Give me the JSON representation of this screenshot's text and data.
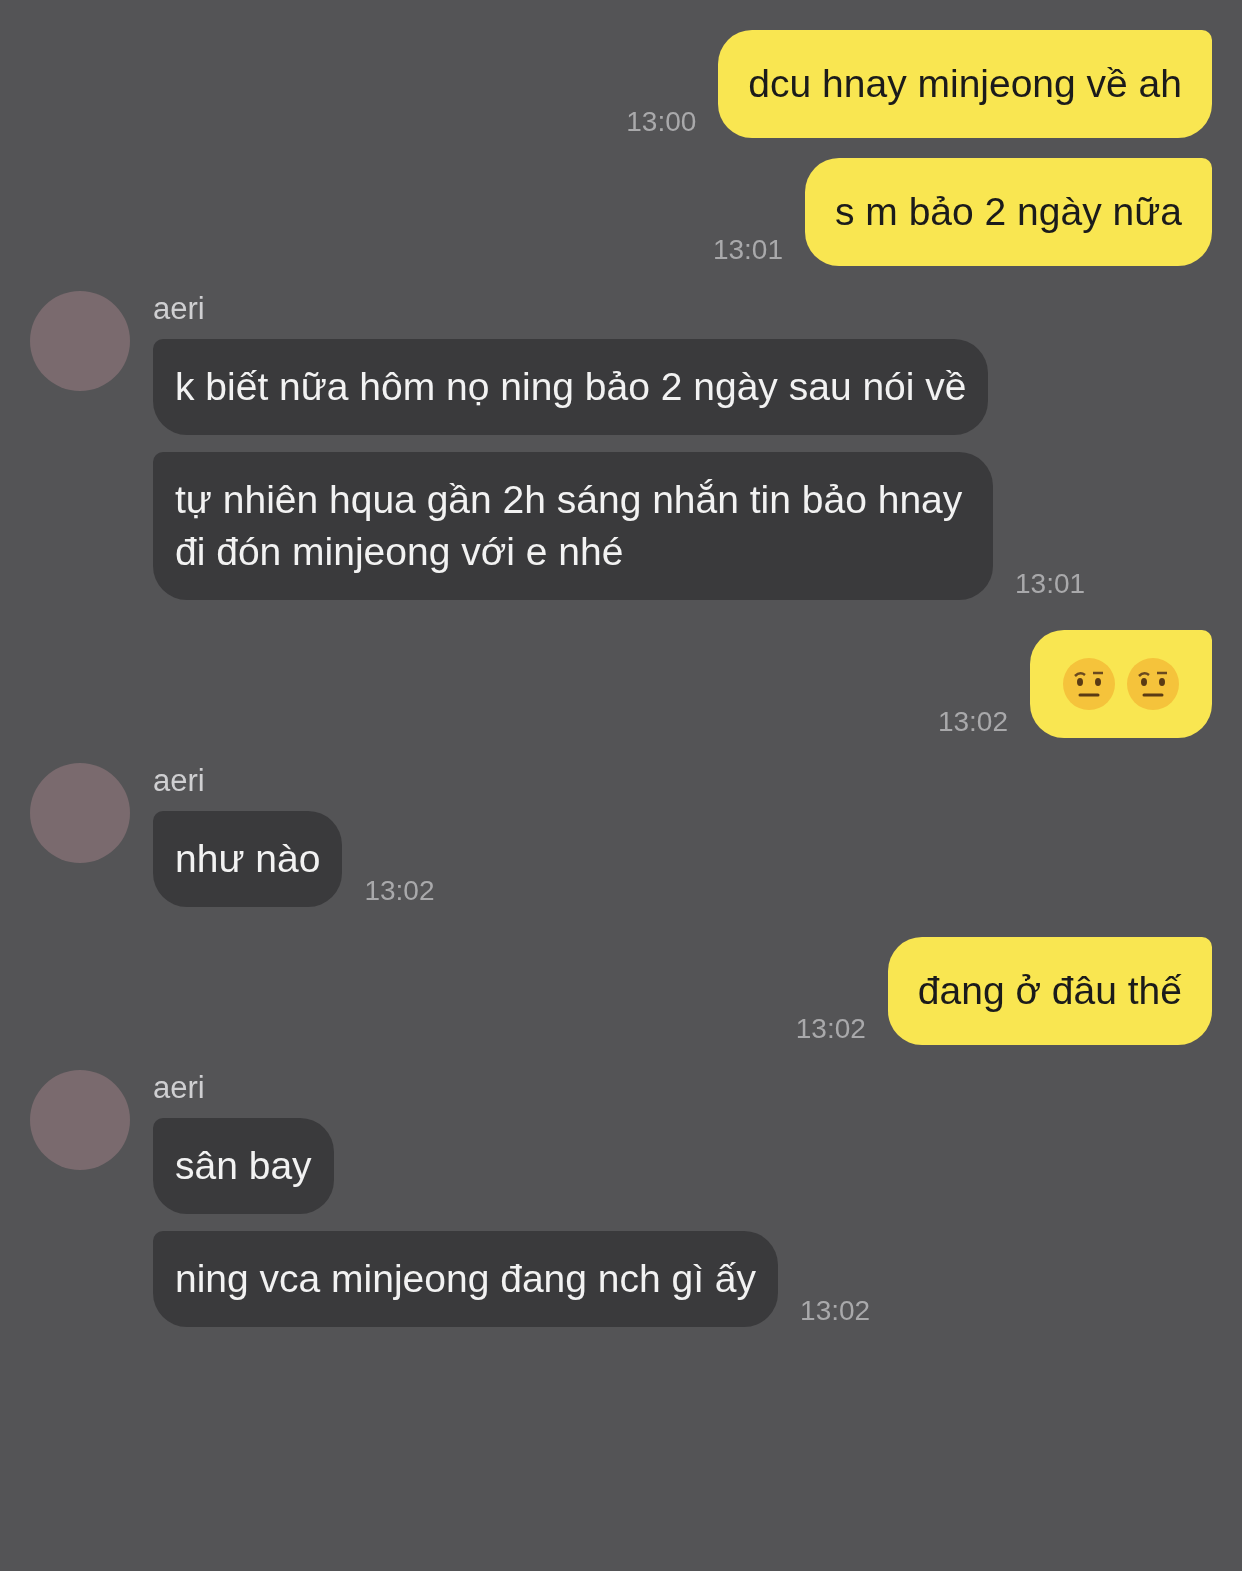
{
  "messages": [
    {
      "kind": "sent",
      "text": "dcu hnay minjeong về ah",
      "time": "13:00"
    },
    {
      "kind": "sent",
      "text": "s m bảo 2 ngày nữa",
      "time": "13:01"
    },
    {
      "kind": "received",
      "name": "aeri",
      "bubbles": [
        "k biết nữa hôm nọ ning bảo 2 ngày sau nói về",
        "tự nhiên hqua gần 2h sáng nhắn tin bảo hnay đi đón minjeong với e nhé"
      ],
      "time": "13:01"
    },
    {
      "kind": "emoji",
      "time": "13:02"
    },
    {
      "kind": "received",
      "name": "aeri",
      "bubbles": [
        "như nào"
      ],
      "time": "13:02"
    },
    {
      "kind": "sent",
      "text": "đang ở đâu thế",
      "time": "13:02"
    },
    {
      "kind": "received",
      "name": "aeri",
      "bubbles": [
        "sân bay",
        "ning vca minjeong đang nch gì ấy"
      ],
      "time": "13:02"
    }
  ]
}
